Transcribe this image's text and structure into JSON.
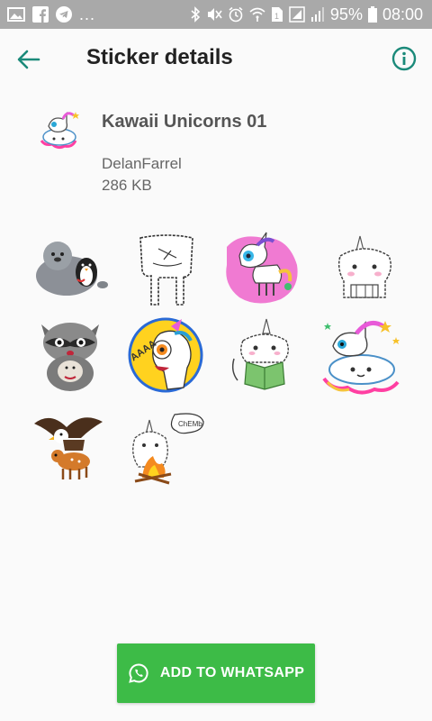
{
  "status_bar": {
    "notification_dots": "...",
    "battery_percent": "95%",
    "time": "08:00"
  },
  "toolbar": {
    "title": "Sticker details",
    "back_icon": "arrow-left-icon",
    "info_icon": "info-circle-icon"
  },
  "pack": {
    "name": "Kawaii Unicorns 01",
    "publisher": "DelanFarrel",
    "size": "286 KB"
  },
  "stickers": [
    {
      "name": "seal-with-penguin"
    },
    {
      "name": "sketch-figure"
    },
    {
      "name": "unicorn-pink-blob"
    },
    {
      "name": "unicorn-sketch-face"
    },
    {
      "name": "raccoon-hug"
    },
    {
      "name": "unicorn-aaaa"
    },
    {
      "name": "unicorn-reading-book"
    },
    {
      "name": "unicorn-on-cloud"
    },
    {
      "name": "eagle-and-deer"
    },
    {
      "name": "unicorn-campfire"
    }
  ],
  "add_button": {
    "label": "ADD TO WHATSAPP",
    "icon": "whatsapp-icon"
  },
  "colors": {
    "accent": "#1b8a7a",
    "button_green": "#3dbb47",
    "status_bar": "#a9a9a9"
  }
}
